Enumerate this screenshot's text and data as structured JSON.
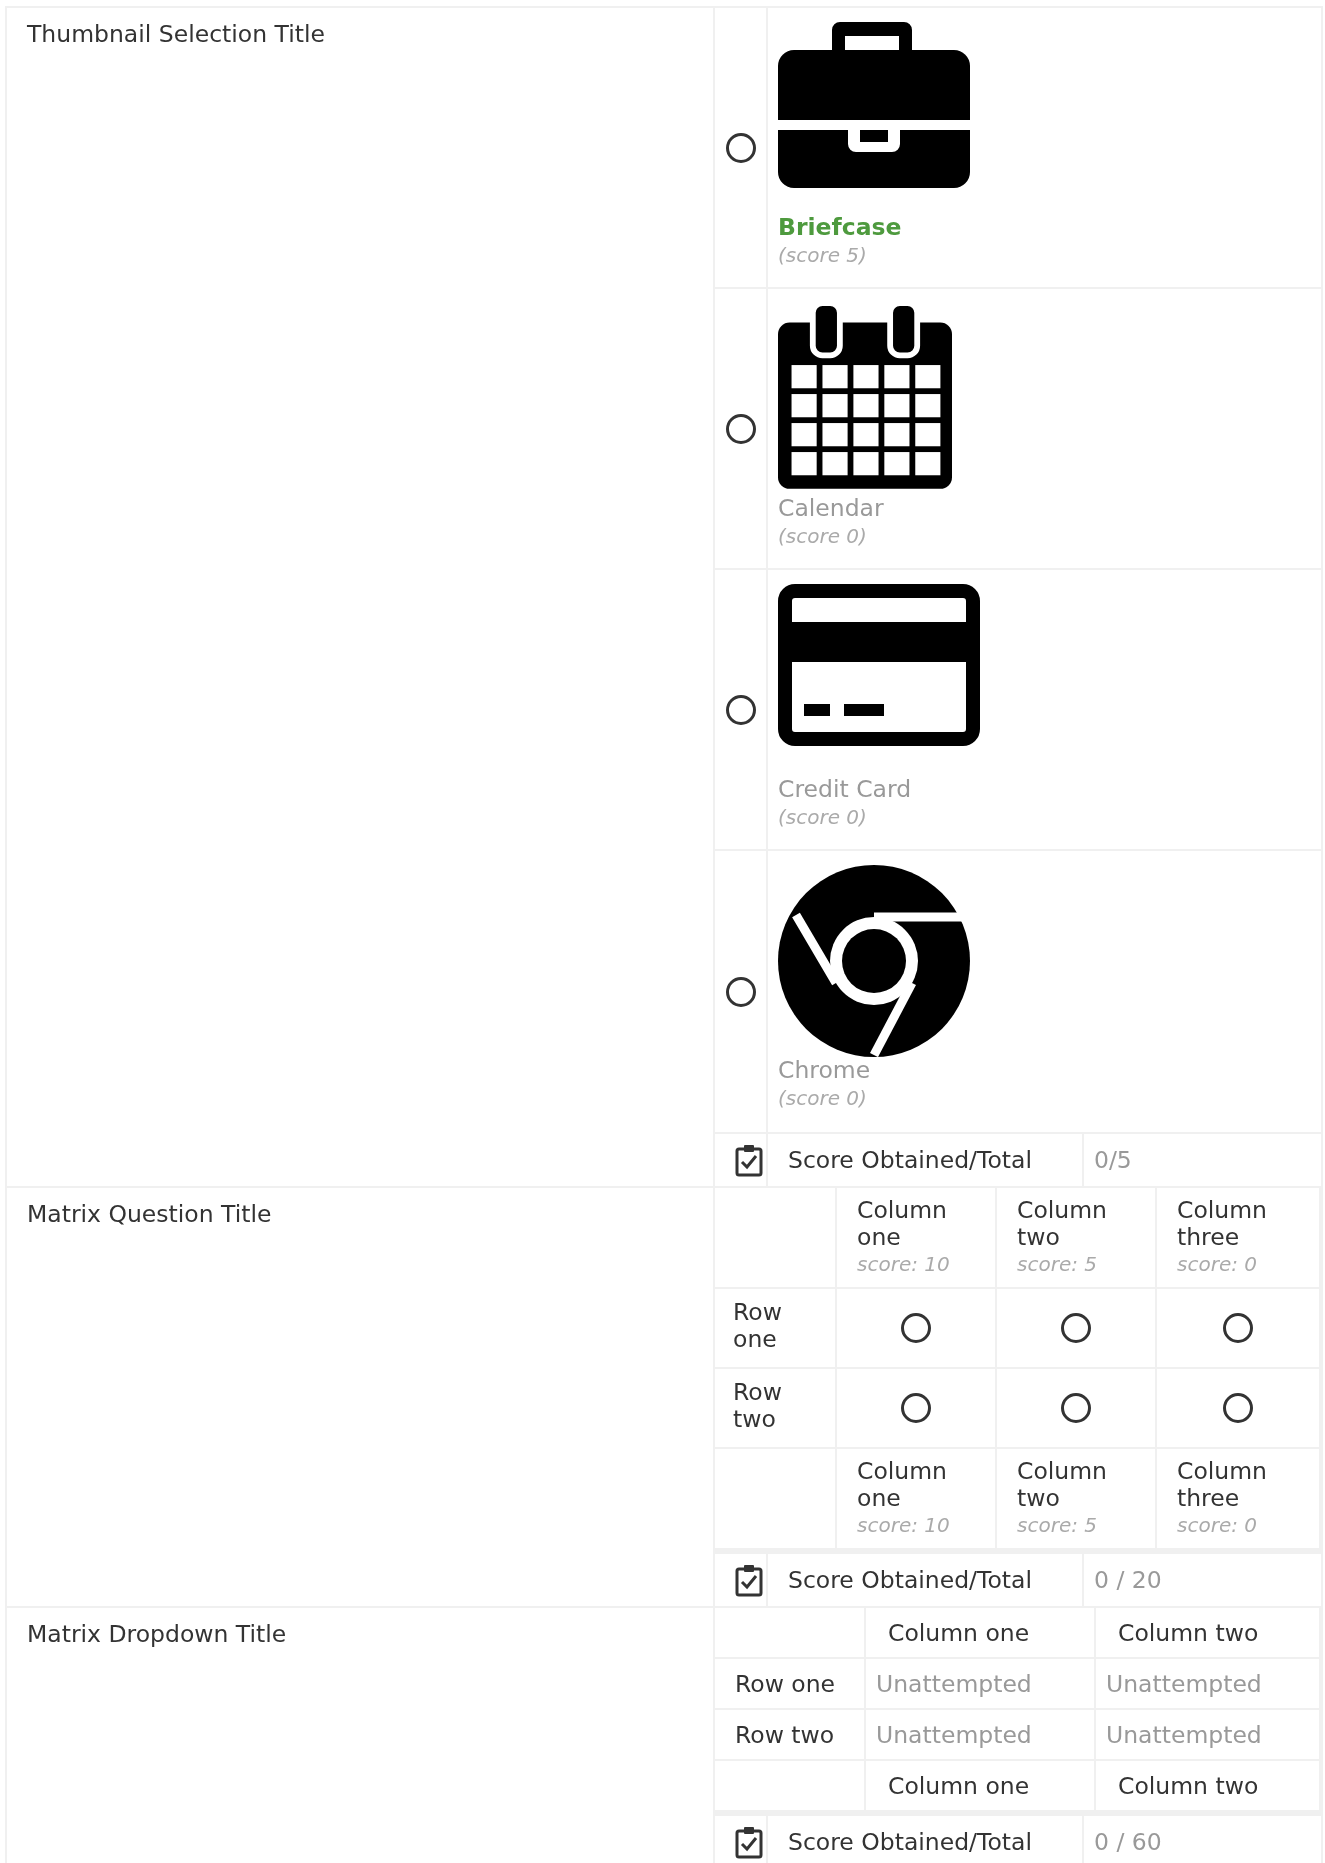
{
  "questions": [
    {
      "kind": "thumbnail",
      "title": "Thumbnail Selection Title",
      "options": [
        {
          "label": "Briefcase",
          "score": "(score 5)",
          "selected": false,
          "correct": true
        },
        {
          "label": "Calendar",
          "score": "(score 0)",
          "selected": false,
          "correct": false
        },
        {
          "label": "Credit Card",
          "score": "(score 0)",
          "selected": false,
          "correct": false
        },
        {
          "label": "Chrome",
          "score": "(score 0)",
          "selected": false,
          "correct": false
        }
      ],
      "score_label": "Score Obtained/Total",
      "score_value": "0/5"
    },
    {
      "kind": "matrix",
      "title": "Matrix Question Title",
      "columns": [
        {
          "label": "Column one",
          "score": "score: 10"
        },
        {
          "label": "Column two",
          "score": "score: 5"
        },
        {
          "label": "Column three",
          "score": "score: 0"
        }
      ],
      "rows": [
        {
          "label": "Row one",
          "cells": [
            {
              "selected": false
            },
            {
              "selected": false
            },
            {
              "selected": false
            }
          ]
        },
        {
          "label": "Row two",
          "cells": [
            {
              "selected": false
            },
            {
              "selected": false
            },
            {
              "selected": false
            }
          ]
        }
      ],
      "footer_columns": [
        {
          "label": "Column one",
          "score": "score: 10"
        },
        {
          "label": "Column two",
          "score": "score: 5"
        },
        {
          "label": "Column three",
          "score": "score: 0"
        }
      ],
      "score_label": "Score Obtained/Total",
      "score_value": "0 / 20"
    },
    {
      "kind": "dropdown_matrix",
      "title": "Matrix Dropdown Title",
      "columns": [
        "Column one",
        "Column two"
      ],
      "rows": [
        {
          "label": "Row one",
          "cells": [
            "Unattempted",
            "Unattempted"
          ]
        },
        {
          "label": "Row two",
          "cells": [
            "Unattempted",
            "Unattempted"
          ]
        }
      ],
      "footer_columns": [
        "Column one",
        "Column two"
      ],
      "score_label": "Score Obtained/Total",
      "score_value": "0 / 60"
    }
  ]
}
